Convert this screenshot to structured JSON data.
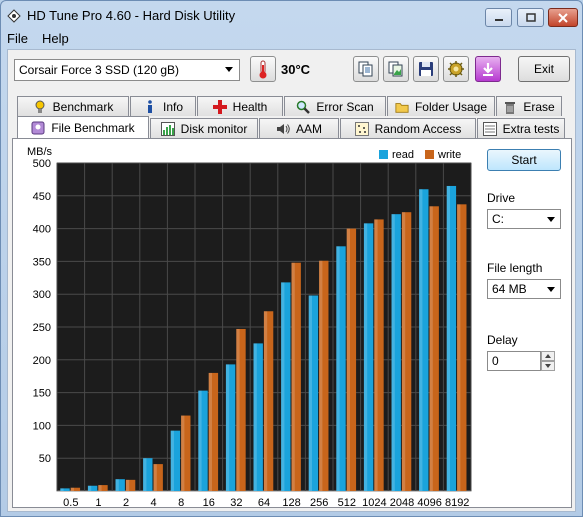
{
  "window": {
    "title": "HD Tune Pro 4.60 - Hard Disk Utility"
  },
  "menu": {
    "file": "File",
    "help": "Help"
  },
  "toolbar": {
    "drive": "Corsair Force 3 SSD (120 gB)",
    "temperature": "30°C",
    "exit": "Exit"
  },
  "tabs_top": [
    {
      "label": "Benchmark",
      "icon": "gauge-icon"
    },
    {
      "label": "Info",
      "icon": "info-icon"
    },
    {
      "label": "Health",
      "icon": "health-cross-icon"
    },
    {
      "label": "Error Scan",
      "icon": "magnifier-icon"
    },
    {
      "label": "Folder Usage",
      "icon": "folder-icon"
    },
    {
      "label": "Erase",
      "icon": "trash-icon"
    }
  ],
  "tabs_bottom": [
    {
      "label": "File Benchmark",
      "icon": "file-benchmark-icon"
    },
    {
      "label": "Disk monitor",
      "icon": "bar-chart-icon"
    },
    {
      "label": "AAM",
      "icon": "speaker-icon"
    },
    {
      "label": "Random Access",
      "icon": "dots-icon"
    },
    {
      "label": "Extra tests",
      "icon": "extra-tests-icon"
    }
  ],
  "side": {
    "start": "Start",
    "drive_label": "Drive",
    "drive_value": "C:",
    "file_length_label": "File length",
    "file_length_value": "64 MB",
    "delay_label": "Delay",
    "delay_value": "0"
  },
  "colors": {
    "read": "#1aa3dc",
    "write": "#c8651b",
    "plot_bg": "#1c1c1c"
  },
  "chart_data": {
    "type": "bar",
    "ylabel": "MB/s",
    "ylim": [
      0,
      500
    ],
    "yticks": [
      50,
      100,
      150,
      200,
      250,
      300,
      350,
      400,
      450,
      500
    ],
    "categories": [
      "0.5",
      "1",
      "2",
      "4",
      "8",
      "16",
      "32",
      "64",
      "128",
      "256",
      "512",
      "1024",
      "2048",
      "4096",
      "8192"
    ],
    "legend_position": "top-right",
    "series": [
      {
        "name": "read",
        "values": [
          4,
          8,
          18,
          50,
          92,
          153,
          193,
          225,
          318,
          298,
          373,
          408,
          422,
          460,
          465
        ]
      },
      {
        "name": "write",
        "values": [
          5,
          9,
          17,
          41,
          115,
          180,
          247,
          274,
          348,
          351,
          400,
          414,
          425,
          434,
          437
        ]
      }
    ]
  }
}
